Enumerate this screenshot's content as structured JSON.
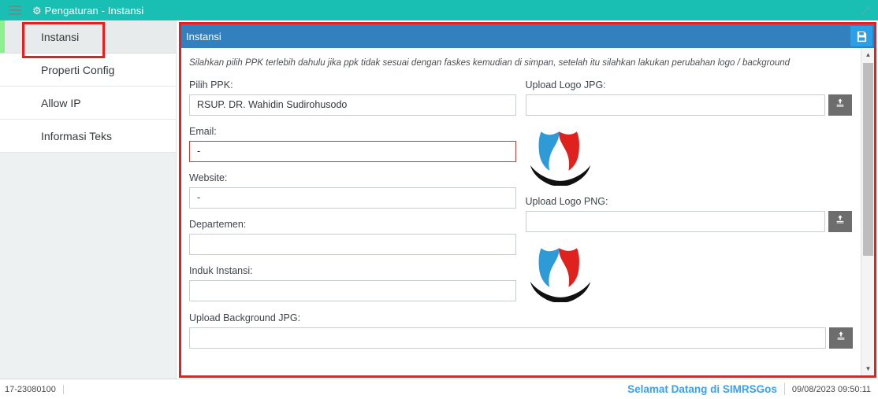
{
  "titlebar": {
    "menu_icon": "hamburger-icon",
    "gear_icon": "gear-icon",
    "title": "Pengaturan - Instansi",
    "resize_icon": "resize-diagonal-icon"
  },
  "sidebar": {
    "items": [
      {
        "label": "Instansi",
        "active": true
      },
      {
        "label": "Properti Config",
        "active": false
      },
      {
        "label": "Allow IP",
        "active": false
      },
      {
        "label": "Informasi Teks",
        "active": false
      }
    ]
  },
  "panel": {
    "title": "Instansi",
    "save_icon": "save-floppy-icon",
    "hint": "Silahkan pilih PPK terlebih dahulu jika ppk tidak sesuai dengan faskes kemudian di simpan, setelah itu silahkan lakukan perubahan logo / background",
    "fields": {
      "pilih_ppk": {
        "label": "Pilih PPK:",
        "value": "RSUP. DR. Wahidin Sudirohusodo",
        "placeholder": ""
      },
      "email": {
        "label": "Email:",
        "value": "-",
        "placeholder": ""
      },
      "website": {
        "label": "Website:",
        "value": "-",
        "placeholder": ""
      },
      "departemen": {
        "label": "Departemen:",
        "value": "",
        "placeholder": ""
      },
      "induk_instansi": {
        "label": "Induk Instansi:",
        "value": "",
        "placeholder": ""
      },
      "upload_logo_jpg": {
        "label": "Upload Logo JPG:",
        "value": "",
        "placeholder": ""
      },
      "upload_logo_png": {
        "label": "Upload Logo PNG:",
        "value": "",
        "placeholder": ""
      },
      "upload_background_jpg": {
        "label": "Upload Background JPG:",
        "value": "",
        "placeholder": ""
      }
    },
    "upload_icon": "upload-arrow-icon",
    "logo_jpg_preview": "instansi-logo",
    "logo_png_preview": "instansi-logo"
  },
  "scrollbar": {
    "up_arrow": "chevron-up-icon",
    "down_arrow": "chevron-down-icon"
  },
  "statusbar": {
    "code": "17-23080100",
    "welcome": "Selamat Datang di SIMRSGos",
    "datetime": "09/08/2023 09:50:11"
  },
  "colors": {
    "header_teal": "#1abfb4",
    "panel_blue": "#3380bf",
    "highlight_red": "#ee1c1c",
    "accent_green": "#8cf08c",
    "save_blue": "#29a0e8",
    "welcome_blue": "#3aa0f0",
    "error_border": "#b5453a",
    "logo_blue": "#2e9bd6",
    "logo_red": "#e0221f"
  }
}
